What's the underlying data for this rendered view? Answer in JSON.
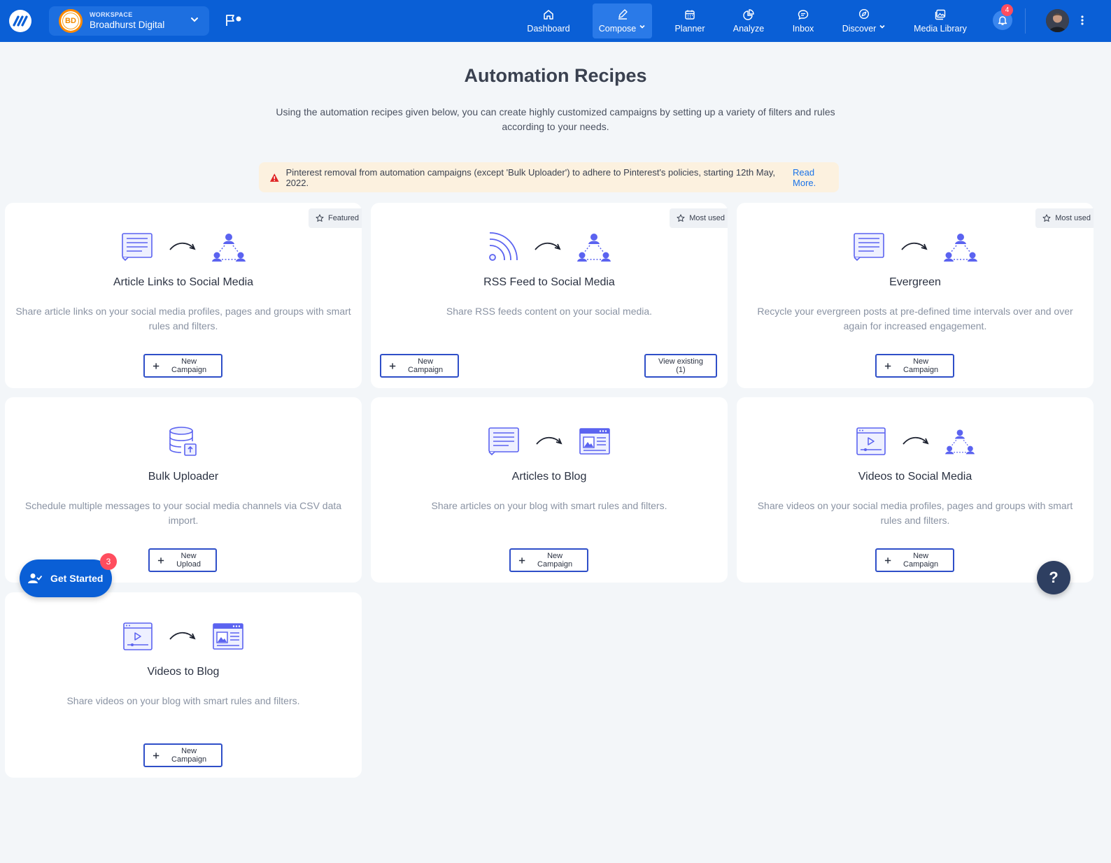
{
  "topbar": {
    "workspace_label": "WORKSPACE",
    "workspace_name": "Broadhurst Digital",
    "workspace_initials": "BD",
    "notifications_count": "4",
    "nav": [
      {
        "label": "Dashboard",
        "icon": "home-icon"
      },
      {
        "label": "Compose",
        "icon": "pen-icon",
        "active": true,
        "dropdown": true
      },
      {
        "label": "Planner",
        "icon": "calendar-icon"
      },
      {
        "label": "Analyze",
        "icon": "pie-chart-icon"
      },
      {
        "label": "Inbox",
        "icon": "chat-icon"
      },
      {
        "label": "Discover",
        "icon": "compass-icon",
        "dropdown": true
      },
      {
        "label": "Media Library",
        "icon": "images-icon"
      }
    ],
    "brand_color": "#0a5fd6"
  },
  "header": {
    "title": "Automation Recipes",
    "subtitle": "Using the automation recipes given below, you can create highly customized campaigns by setting up a variety of filters and rules according to your needs."
  },
  "alert": {
    "text": "Pinterest removal from automation campaigns (except 'Bulk Uploader') to adhere to Pinterest's policies, starting 12th May, 2022.",
    "link": "Read More."
  },
  "cards": [
    {
      "title": "Article Links to Social Media",
      "desc": "Share article links on your social media profiles, pages and groups with smart rules and filters.",
      "tag": "Featured",
      "button": "New Campaign"
    },
    {
      "title": "RSS Feed to Social Media",
      "desc": "Share RSS feeds content on your social media.",
      "tag": "Most used",
      "button": "New Campaign",
      "button2": "View existing (1)"
    },
    {
      "title": "Evergreen",
      "desc": "Recycle your evergreen posts at pre-defined time intervals over and over again for increased engagement.",
      "tag": "Most used",
      "button": "New Campaign"
    },
    {
      "title": "Bulk Uploader",
      "desc": "Schedule multiple messages to your social media channels via CSV data import.",
      "button": "New Upload"
    },
    {
      "title": "Articles to Blog",
      "desc": "Share articles on your blog with smart rules and filters.",
      "button": "New Campaign"
    },
    {
      "title": "Videos to Social Media",
      "desc": "Share videos on your social media profiles, pages and groups with smart rules and filters.",
      "button": "New Campaign"
    },
    {
      "title": "Videos to Blog",
      "desc": "Share videos on your blog with smart rules and filters.",
      "button": "New Campaign"
    }
  ],
  "floating": {
    "get_started": "Get Started",
    "get_started_badge": "3",
    "help": "?"
  },
  "colors": {
    "accent": "#5b63f0",
    "button_border": "#2f4fc8",
    "alert_bg": "#fcf1df",
    "badge": "#ff4d5e"
  }
}
